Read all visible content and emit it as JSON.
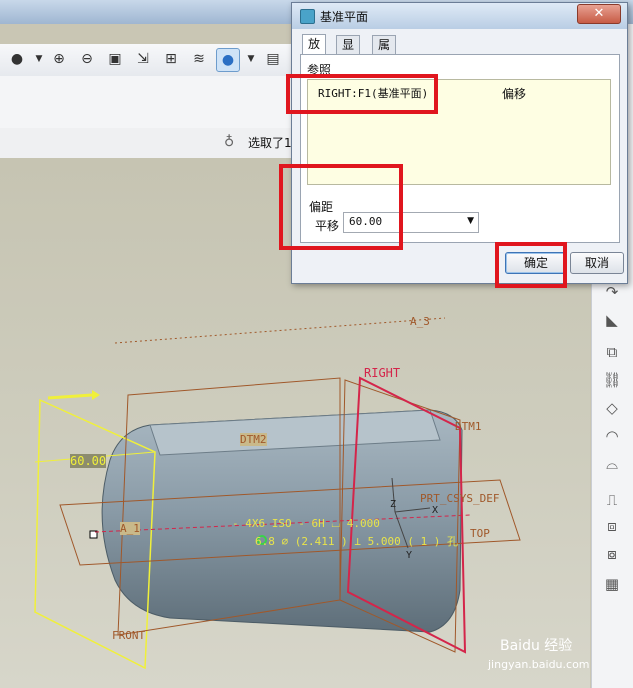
{
  "toolbar": {
    "icons": [
      "shading-icon",
      "dropdown-icon",
      "zoom-in-icon",
      "zoom-out-icon",
      "refit-icon",
      "reorient-icon",
      "view-manager-icon",
      "layers-icon",
      "display-style-icon",
      "dropdown-icon",
      "saved-views-icon"
    ]
  },
  "status": {
    "selection_text": "选取了1"
  },
  "dialog": {
    "title": "基准平面",
    "close": "✕",
    "tabs": [
      "放置",
      "显示",
      "属性"
    ],
    "references_label": "参照",
    "reference_item": "RIGHT:F1(基准平面)",
    "reference_type": "偏移",
    "offset_section_label": "偏距",
    "translate_label": "平移",
    "translate_value": "60.00",
    "ok_button": "确定",
    "cancel_button": "取消"
  },
  "model_labels": {
    "a3": "A_3",
    "right": "RIGHT",
    "dtm1": "DTM1",
    "dtm2": "DTM2",
    "dimension": "60.00",
    "a1": "A_1",
    "prt_csys": "PRT_CSYS_DEF",
    "top": "TOP",
    "front": "FRONT",
    "z": "Z",
    "y": "Y",
    "x": "X",
    "hole_note_line1": "- 4X6 ISO - 6H ⌴ 4.000",
    "hole_note_line2": "6.8 ⌀ (2.411 ) ⊥ 5.000 ( 1 ) 孔"
  },
  "watermark": {
    "brand": "Baidu 经验",
    "url": "jingyan.baidu.com"
  },
  "colors": {
    "highlight": "#e0161e",
    "datum_yellow": "#f0f03a",
    "datum_orange": "#a0582a",
    "datum_right": "#d4254a",
    "model_body": "#8496a3"
  }
}
